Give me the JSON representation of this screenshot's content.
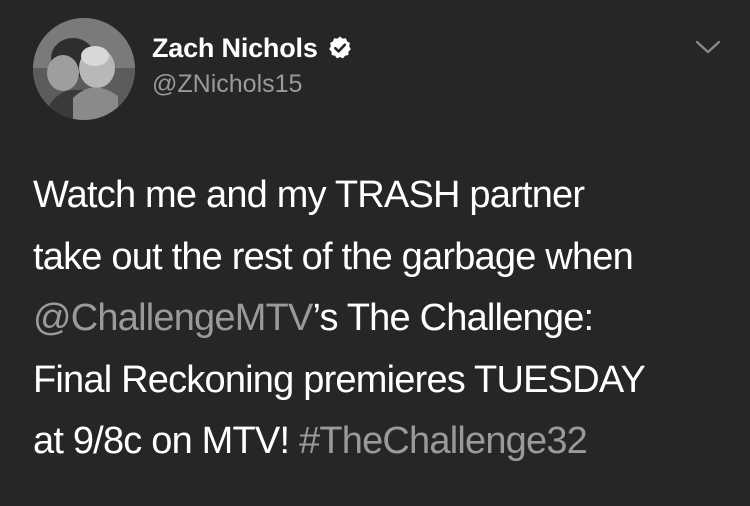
{
  "author": {
    "display_name": "Zach Nichols",
    "handle": "@ZNichols15",
    "verified": true,
    "avatar_icon": "profile-photo"
  },
  "menu": {
    "icon": "chevron-down-icon"
  },
  "tweet": {
    "line1": "Watch me and my TRASH partner",
    "line2": "take out the rest of the garbage when",
    "mention": "@ChallengeMTV",
    "line3_rest": "’s The Challenge:",
    "line4": "Final Reckoning premieres TUESDAY",
    "line5_text": "at 9/8c on MTV! ",
    "hashtag": "#TheChallenge32"
  },
  "colors": {
    "background": "#262626",
    "primary_text": "#ffffff",
    "secondary_text": "#9a9a9a"
  }
}
